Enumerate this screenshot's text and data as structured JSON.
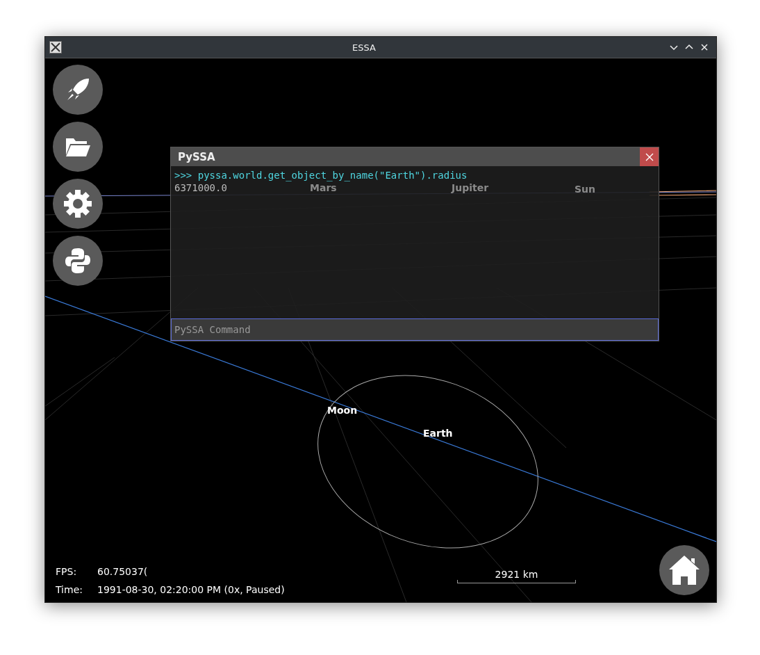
{
  "window": {
    "title": "ESSA"
  },
  "scene_labels": [
    {
      "text": "Mars",
      "kind": "faded"
    },
    {
      "text": "Jupiter",
      "kind": "faded"
    },
    {
      "text": "Sun",
      "kind": "faded"
    },
    {
      "text": "Moon",
      "kind": "bright"
    },
    {
      "text": "Earth",
      "kind": "bright"
    }
  ],
  "console": {
    "title": "PySSA",
    "lines": [
      {
        "kind": "command",
        "text": ">>> pyssa.world.get_object_by_name(\"Earth\").radius"
      },
      {
        "kind": "result",
        "text": "6371000.0"
      }
    ],
    "input": {
      "placeholder": "PySSA Command"
    }
  },
  "stats": [
    {
      "label": "FPS:",
      "value": "60.75037("
    },
    {
      "label": "Time:",
      "value": "1991-08-30, 02:20:00 PM (0x, Paused)"
    }
  ],
  "scale": {
    "text": "2921 km"
  }
}
